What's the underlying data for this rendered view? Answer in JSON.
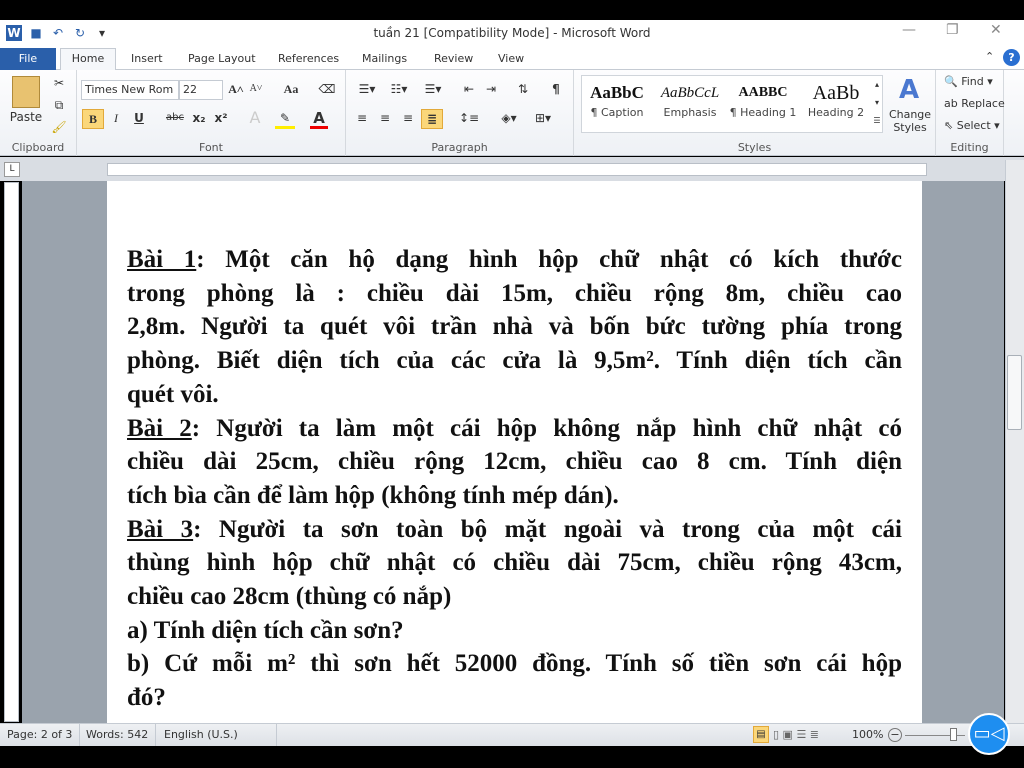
{
  "window": {
    "title": "tuần 21 [Compatibility Mode]  -  Microsoft Word"
  },
  "tabs": [
    "File",
    "Home",
    "Insert",
    "Page Layout",
    "References",
    "Mailings",
    "Review",
    "View"
  ],
  "ribbon": {
    "clipboard": {
      "label": "Clipboard",
      "paste": "Paste"
    },
    "font": {
      "label": "Font",
      "font_name": "Times New Rom",
      "font_size": "22",
      "bold": "B",
      "italic": "I",
      "underline": "U",
      "strike": "abc",
      "subscript": "x₂",
      "superscript": "x²",
      "change_case": "Aa"
    },
    "paragraph": {
      "label": "Paragraph",
      "pilcrow": "¶"
    },
    "styles": {
      "label": "Styles",
      "items": [
        {
          "sample": "AaBbC",
          "name": "¶ Caption"
        },
        {
          "sample": "AaBbCcL",
          "name": "Emphasis"
        },
        {
          "sample": "AABBC",
          "name": "¶ Heading 1"
        },
        {
          "sample": "AaBb",
          "name": "Heading 2"
        }
      ],
      "change_styles": "Change Styles"
    },
    "editing": {
      "label": "Editing",
      "find": "Find",
      "replace": "Replace",
      "select": "Select"
    }
  },
  "document": {
    "lines": [
      {
        "u": "Bài 1",
        "t": ": Một căn hộ dạng hình hộp chữ nhật có kích thước"
      },
      {
        "u": "",
        "t": "trong phòng là : chiều dài 15m, chiều rộng 8m, chiều cao"
      },
      {
        "u": "",
        "t": "2,8m. Người ta quét vôi trần nhà và bốn bức tường phía trong"
      },
      {
        "u": "",
        "t": "phòng. Biết diện tích của các cửa là 9,5m². Tính diện tích cần"
      },
      {
        "u": "",
        "t": "quét vôi.",
        "last": true
      },
      {
        "u": "Bài 2",
        "t": ": Người ta làm một cái hộp không nắp hình chữ nhật có"
      },
      {
        "u": "",
        "t": "chiều dài 25cm, chiều rộng 12cm, chiều cao 8 cm. Tính diện"
      },
      {
        "u": "",
        "t": "tích bìa cần để làm hộp (không tính mép dán).",
        "last": true
      },
      {
        "u": "Bài 3",
        "t": ": Người ta sơn toàn bộ mặt ngoài và trong của một cái"
      },
      {
        "u": "",
        "t": "thùng hình hộp chữ nhật có chiều dài 75cm, chiều rộng 43cm,"
      },
      {
        "u": "",
        "t": "chiều cao 28cm (thùng có nắp)",
        "last": true
      },
      {
        "u": "",
        "t": "a) Tính diện tích cần sơn?",
        "last": true
      },
      {
        "u": "",
        "t": "b) Cứ mỗi m² thì sơn hết 52000 đồng. Tính số tiền sơn cái hộp"
      },
      {
        "u": "",
        "t": "đó?",
        "last": true
      }
    ]
  },
  "status": {
    "page": "Page: 2 of 3",
    "words": "Words: 542",
    "language": "English (U.S.)",
    "zoom": "100%"
  },
  "colors": {
    "file_tab": "#2a5faa",
    "record_button": "#1e8ef0"
  }
}
